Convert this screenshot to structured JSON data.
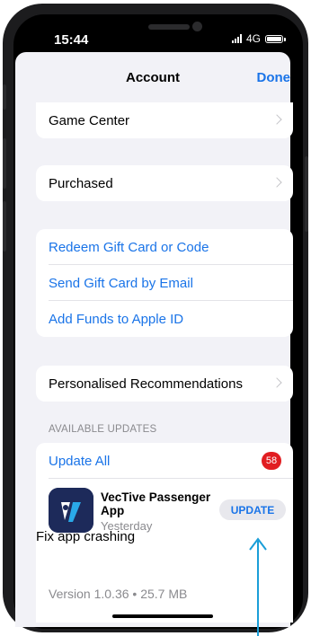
{
  "status": {
    "time": "15:44",
    "network": "4G"
  },
  "nav": {
    "title": "Account",
    "done_label": "Done"
  },
  "rows": {
    "game_center": "Game Center",
    "purchased": "Purchased",
    "redeem": "Redeem Gift Card or Code",
    "send_gift": "Send Gift Card by Email",
    "add_funds": "Add Funds to Apple ID",
    "recommendations": "Personalised Recommendations"
  },
  "updates": {
    "section_header": "AVAILABLE UPDATES",
    "update_all_label": "Update All",
    "badge_count": "58",
    "app": {
      "name": "VecTive Passenger App",
      "date": "Yesterday",
      "button_label": "UPDATE",
      "release_notes": "Fix app crashing",
      "version_info": "Version 1.0.36 • 25.7 MB"
    }
  },
  "colors": {
    "accent": "#1a74e8",
    "badge": "#e11d21",
    "annotation_arrow": "#1a9ed8",
    "sheet_background": "#f2f2f7"
  }
}
